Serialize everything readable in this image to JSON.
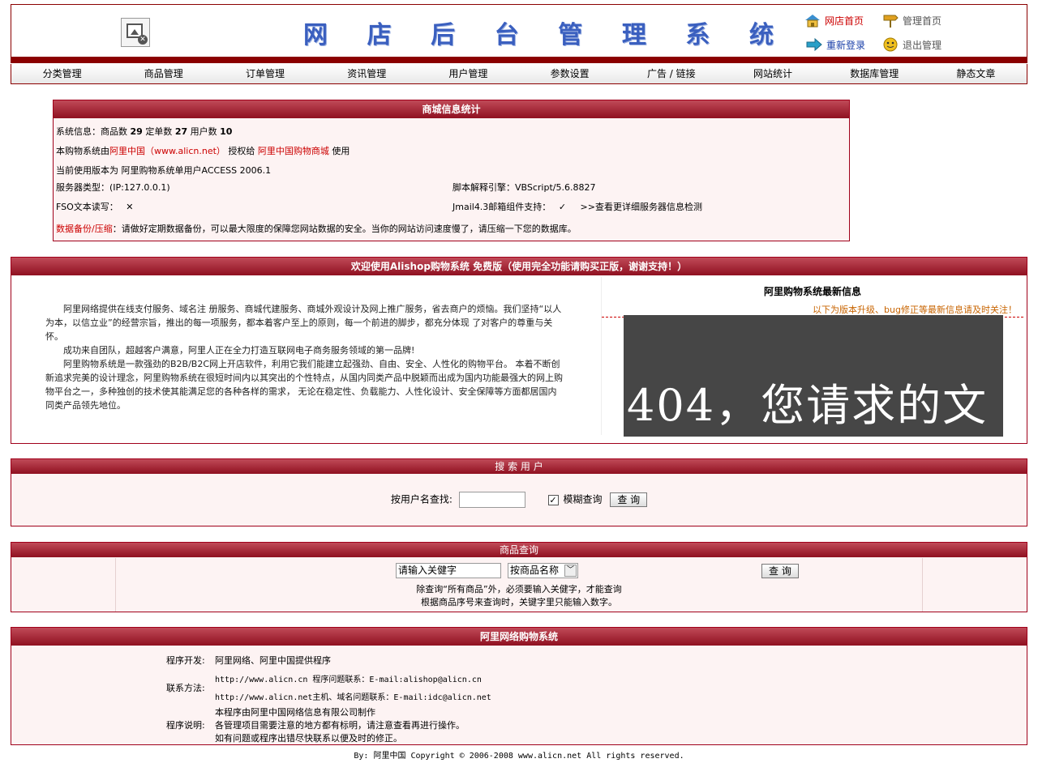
{
  "header": {
    "title_chars": [
      "网",
      "店",
      "后",
      "台",
      "管",
      "理",
      "系",
      "统"
    ],
    "links": {
      "shop_home": "网店首页",
      "admin_home": "管理首页",
      "relogin": "重新登录",
      "logout": "退出管理"
    }
  },
  "nav": [
    "分类管理",
    "商品管理",
    "订单管理",
    "资讯管理",
    "用户管理",
    "参数设置",
    "广告 / 链接",
    "网站统计",
    "数据库管理",
    "静态文章"
  ],
  "stats": {
    "title": "商城信息统计",
    "sys_label": "系统信息：商品数",
    "goods": "29",
    "orders_label": "定单数",
    "orders": "27",
    "users_label": "用户数",
    "users": "10",
    "license_pre": "本购物系统由",
    "license_owner": "阿里中国（www.alicn.net）",
    "license_mid": "授权给",
    "license_to": "阿里中国购物商城",
    "license_post": "使用",
    "version": "当前使用版本为 阿里购物系统单用户ACCESS 2006.1",
    "server_type": "服务器类型：(IP:127.0.0.1)",
    "script_engine": "脚本解释引擎：VBScript/5.6.8827",
    "fso": "FSO文本读写：",
    "fso_mark": "✕",
    "jmail": "Jmail4.3邮箱组件支持：",
    "jmail_mark": "✓",
    "server_detail": ">>查看更详细服务器信息检测",
    "backup_label": "数据备份/压缩",
    "backup_text": "：请做好定期数据备份，可以最大限度的保障您网站数据的安全。当你的网站访问速度慢了，请压缩一下您的数据库。"
  },
  "welcome": {
    "title": "欢迎使用Alishop购物系统 免费版（使用完全功能请购买正版，谢谢支持！）",
    "paragraphs": [
      "阿里网络提供在线支付服务、域名注 册服务、商城代建服务、商城外观设计及网上推广服务，省去商户的烦恼。我们坚持“以人为本，以信立业”的经营宗旨，推出的每一项服务，都本着客户至上的原则，每一个前进的脚步，都充分体现 了对客户的尊重与关怀。",
      "成功来自团队，超越客户满意，阿里人正在全力打造互联网电子商务服务领域的第一品牌!",
      "阿里购物系统是一款强劲的B2B/B2C网上开店软件，利用它我们能建立起强劲、自由、安全、人性化的购物平台。 本着不断创新追求完美的设计理念，阿里购物系统在很短时间内以其突出的个性特点，从国内同类产品中脱颖而出成为国内功能最强大的网上购物平台之一，多种独创的技术使其能满足您的各种各样的需求， 无论在稳定性、负载能力、人性化设计、安全保障等方面都居国内同类产品领先地位。"
    ],
    "news_title": "阿里购物系统最新信息",
    "news_sub": "以下为版本升级、bug修正等最新信息请及时关注！",
    "frame_text": "404，您请求的文"
  },
  "search_user": {
    "title": "搜 索 用 户",
    "label": "按用户名查找:",
    "value": "",
    "fuzzy_label": "模糊查询",
    "checked": true,
    "button": "查 询"
  },
  "product_query": {
    "title": "商品查询",
    "keyword_value": "请输入关健字",
    "select_value": "按商品名称",
    "button": "查 询",
    "hint1": "除查询“所有商品”外，必须要输入关健字，才能查询",
    "hint2": "根据商品序号来查询时，关键字里只能输入数字。"
  },
  "about": {
    "title": "阿里网络购物系统",
    "dev_label": "程序开发:",
    "dev_value": "阿里网络、阿里中国提供程序",
    "contact_label": "联系方法:",
    "contact1": "http://www.alicn.cn 程序问题联系：E-mail:alishop@alicn.cn",
    "contact2": "http://www.alicn.net主机、域名问题联系：E-mail:idc@alicn.net",
    "note_label": "程序说明:",
    "note1": "本程序由阿里中国网络信息有限公司制作",
    "note2": "各管理项目需要注意的地方都有标明，请注意查看再进行操作。",
    "note3": "如有问题或程序出错尽快联系以便及时的修正。"
  },
  "footer": "By: 阿里中国 Copyright © 2006-2008 www.alicn.net All rights reserved."
}
